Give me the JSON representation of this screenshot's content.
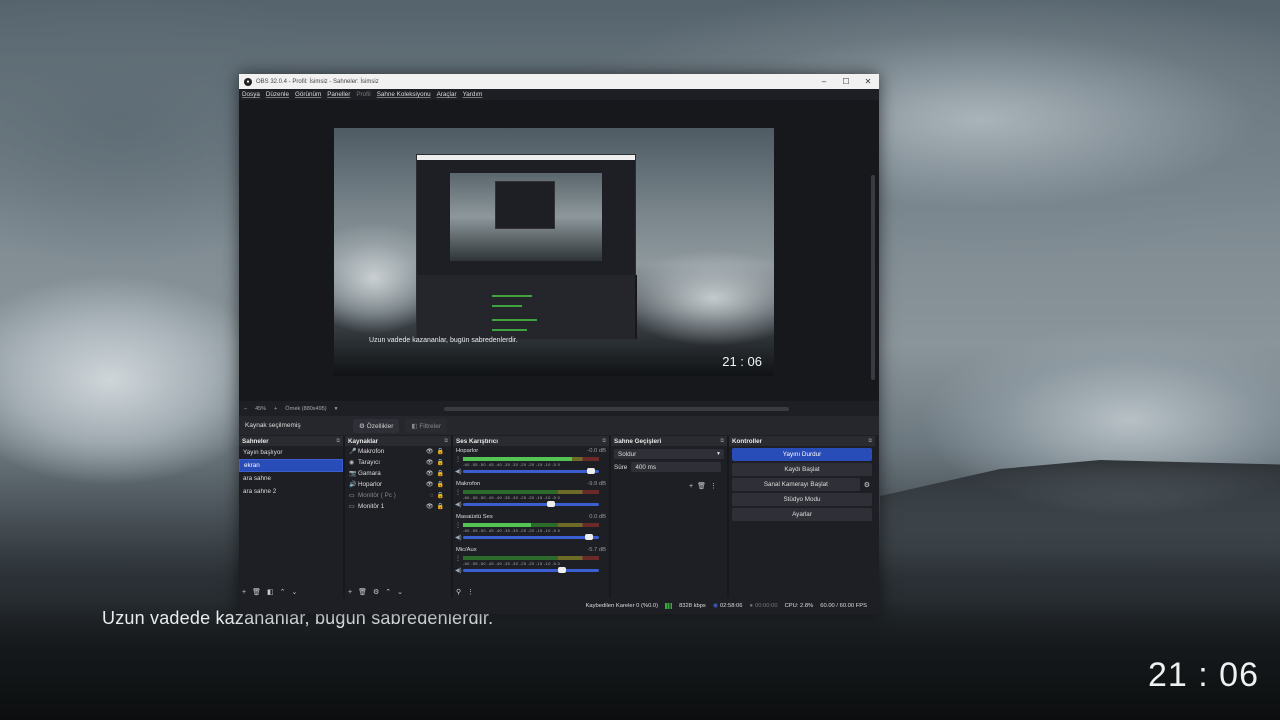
{
  "desktop": {
    "quote": "Uzun vadede kazananlar, bugün sabredenlerdir.",
    "clock": "21 : 06"
  },
  "window": {
    "title": "OBS 32.0.4 - Profil: İsimsiz - Sahneler: İsimsiz",
    "minimize": "–",
    "maximize": "☐",
    "close": "✕"
  },
  "menu": [
    "Dosya",
    "Düzenle",
    "Görünüm",
    "Paneller",
    "Profil",
    "Sahne Koleksiyonu",
    "Araçlar",
    "Yardım"
  ],
  "preview": {
    "quote": "Uzun vadede kazananlar, bugün sabredenlerdir.",
    "clock": "21 : 06"
  },
  "zoom": {
    "minus": "–",
    "level": "45%",
    "plus": "+",
    "fit": "Örnek (880x495)",
    "caret": "▾"
  },
  "context": {
    "source_label": "Kaynak seçilmemiş",
    "properties": "Özellikler",
    "filters": "Filtreler"
  },
  "scenes": {
    "title": "Sahneler",
    "items": [
      "Yayın başlıyor",
      "ekran",
      "ara sahne",
      "ara sahne 2"
    ],
    "selected": 1
  },
  "sources": {
    "title": "Kaynaklar",
    "items": [
      {
        "icon": "🎤",
        "label": "Makrofon"
      },
      {
        "icon": "◉",
        "label": "Tarayıcı"
      },
      {
        "icon": "📷",
        "label": "Gamara"
      },
      {
        "icon": "🔊",
        "label": "Hoparlor"
      },
      {
        "icon": "▭",
        "label": "Monitör ( Pc )"
      },
      {
        "icon": "▭",
        "label": "Monitör 1"
      }
    ]
  },
  "mixer": {
    "title": "Ses Karıştırıcı",
    "ticks": "-60 -55 -50 -45 -40 -35 -30 -25 -20 -15 -10 -5 0",
    "channels": [
      {
        "name": "Hoparlor",
        "db": "-0.0 dB",
        "level": 0.8,
        "fader": 0.97
      },
      {
        "name": "Makrofon",
        "db": "-9.9 dB",
        "level": 0.0,
        "fader": 0.66
      },
      {
        "name": "Masaüstü Ses",
        "db": "0.0 dB",
        "level": 0.5,
        "fader": 0.95
      },
      {
        "name": "Mic/Aux",
        "db": "-5.7 dB",
        "level": 0.0,
        "fader": 0.74
      }
    ]
  },
  "transitions": {
    "title": "Sahne Geçişleri",
    "type": "Soldur",
    "duration_label": "Süre",
    "duration": "400 ms"
  },
  "controls": {
    "title": "Kontroller",
    "buttons": [
      "Yayını Durdur",
      "Kaydı Başlat",
      "Sanal Kamerayı Başlat",
      "Stüdyo Modu",
      "Ayarlar"
    ]
  },
  "status": {
    "dropped": "Kaybedilen Kareler 0 (%0.0)",
    "bitrate": "8328 kbps",
    "stream_time": "02:58:06",
    "rec_time": "00:00:00",
    "cpu": "CPU: 2.8%",
    "fps": "60.00 / 60.00 FPS"
  },
  "colors": {
    "accent": "#284cb8",
    "meter_green": "#54c454"
  }
}
